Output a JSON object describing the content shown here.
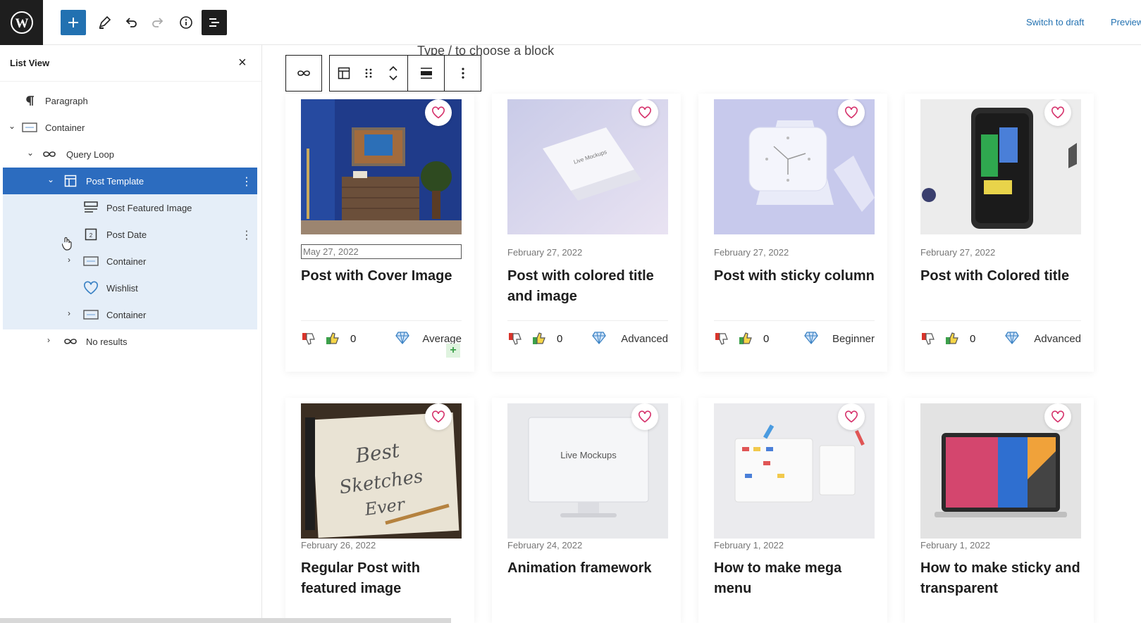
{
  "topbar": {
    "switch_to_draft": "Switch to draft",
    "preview": "Preview"
  },
  "sidebar": {
    "title": "List View",
    "items": [
      {
        "label": "Paragraph"
      },
      {
        "label": "Container"
      },
      {
        "label": "Query Loop"
      },
      {
        "label": "Post Template"
      },
      {
        "label": "Post Featured Image"
      },
      {
        "label": "Post Date"
      },
      {
        "label": "Container"
      },
      {
        "label": "Wishlist"
      },
      {
        "label": "Container"
      },
      {
        "label": "No results"
      }
    ]
  },
  "canvas": {
    "placeholder": "Type / to choose a block",
    "cards": [
      {
        "date": "May 27, 2022",
        "title": "Post with Cover Image",
        "count": "0",
        "level": "Average"
      },
      {
        "date": "February 27, 2022",
        "title": "Post with colored title and image",
        "count": "0",
        "level": "Advanced"
      },
      {
        "date": "February 27, 2022",
        "title": "Post with sticky column",
        "count": "0",
        "level": "Beginner"
      },
      {
        "date": "February 27, 2022",
        "title": "Post with Colored title",
        "count": "0",
        "level": "Advanced"
      },
      {
        "date": "February 26, 2022",
        "title": "Regular Post with featured image"
      },
      {
        "date": "February 24, 2022",
        "title": "Animation framework",
        "img_text": "Live Mockups"
      },
      {
        "date": "February 1, 2022",
        "title": "How to make mega menu"
      },
      {
        "date": "February 1, 2022",
        "title": "How to make sticky and transparent"
      }
    ]
  },
  "colors": {
    "accent": "#2271b1",
    "selected_row": "#2c6cbf",
    "selected_group_bg": "#e5eef8",
    "dark": "#1e1e1e",
    "heart": "#d6336c"
  },
  "icons": [
    "wordpress-logo-icon",
    "plus-icon",
    "pencil-icon",
    "undo-icon",
    "redo-icon",
    "info-icon",
    "list-view-icon",
    "close-icon",
    "paragraph-icon",
    "container-icon",
    "loop-icon",
    "template-icon",
    "featured-image-icon",
    "calendar-icon",
    "heart-icon",
    "chevron-icon",
    "link-icon",
    "drag-handle-icon",
    "move-arrows-icon",
    "align-icon",
    "more-options-icon",
    "thumbs-down-icon",
    "thumbs-up-icon",
    "diamond-icon",
    "add-block-icon"
  ]
}
